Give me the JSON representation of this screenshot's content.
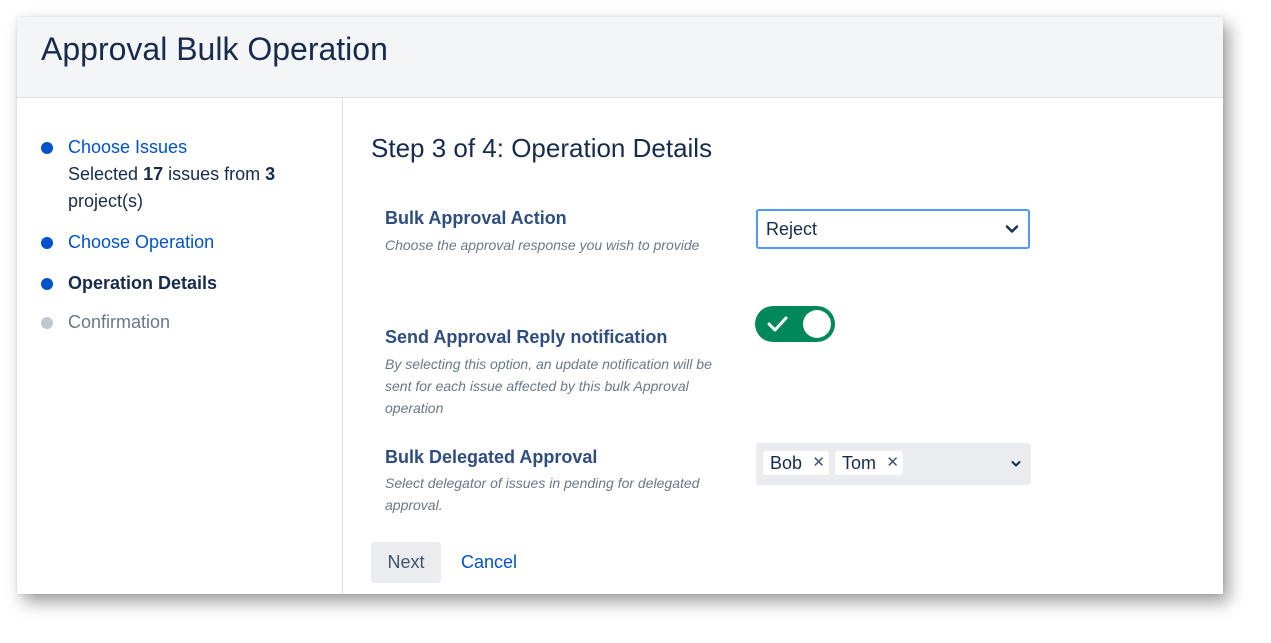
{
  "dialog": {
    "title": "Approval Bulk Operation"
  },
  "steps": {
    "step1": {
      "label": "Choose Issues",
      "summary_prefix": "Selected",
      "issue_count": "17",
      "summary_middle": "issues from",
      "project_count": "3",
      "summary_suffix": "project(s)"
    },
    "step2": {
      "label": "Choose Operation"
    },
    "step3": {
      "label": "Operation Details"
    },
    "step4": {
      "label": "Confirmation"
    }
  },
  "main": {
    "title": "Step 3 of 4: Operation Details",
    "bulk_action": {
      "label": "Bulk Approval Action",
      "description": "Choose the approval response you wish to provide",
      "selected": "Reject"
    },
    "notification": {
      "label": "Send Approval Reply notification",
      "description": "By selecting this option, an update notification will be sent for each issue affected by this bulk Approval operation",
      "enabled": true
    },
    "delegated": {
      "label": "Bulk Delegated Approval",
      "description": "Select delegator of issues in pending for delegated approval.",
      "tags": [
        "Bob",
        "Tom"
      ]
    }
  },
  "buttons": {
    "next": "Next",
    "cancel": "Cancel"
  },
  "icons": {
    "dropdown": "chevron-down-icon",
    "toggle": "check-icon",
    "tag_remove": "close-icon"
  },
  "colors": {
    "accent": "#0052cc",
    "toggle_on": "#00875a",
    "focus_border": "#4c9aff",
    "inactive": "#c1c7d0"
  }
}
